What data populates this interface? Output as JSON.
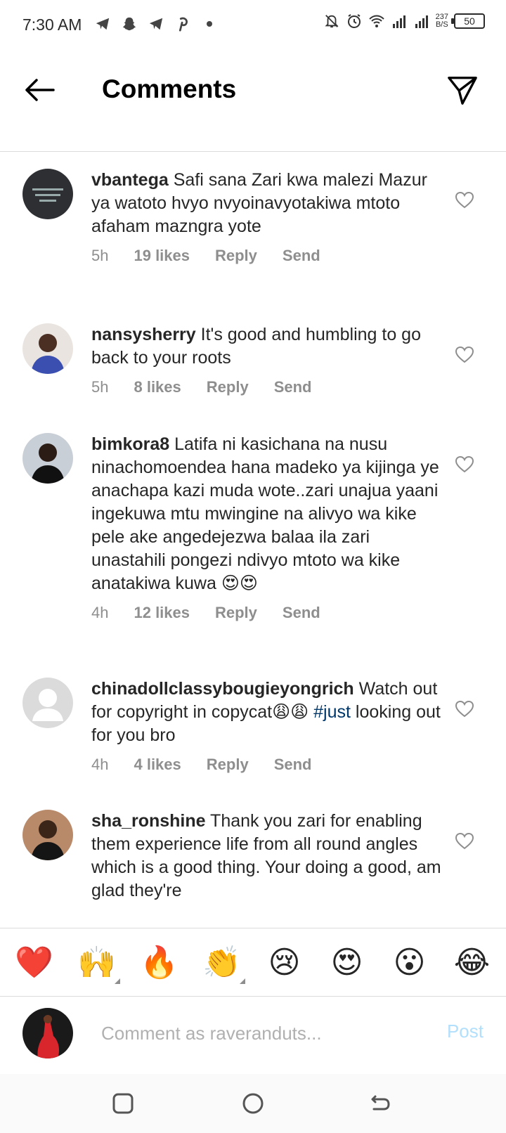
{
  "status_bar": {
    "time": "7:30 AM",
    "net_speed_value": "237",
    "net_speed_unit": "B/S",
    "battery": "50",
    "icons": [
      "telegram-icon",
      "snapchat-icon",
      "telegram-icon",
      "pinterest-icon",
      "dot-icon",
      "mute-icon",
      "alarm-icon",
      "wifi-icon",
      "signal-icon",
      "signal-icon"
    ]
  },
  "header": {
    "title": "Comments",
    "back_icon": "arrow-left-icon",
    "share_icon": "paper-plane-icon"
  },
  "comments": [
    {
      "username": "vbantega",
      "text": " Safi sana Zari kwa malezi Mazur ya watoto hvyo nvyoinavyotakiwa mtoto afaham mazngra yote",
      "time": "5h",
      "likes": "19 likes",
      "reply": "Reply",
      "send": "Send"
    },
    {
      "username": "nansysherry",
      "text": " It's good and humbling to go back to your roots",
      "time": "5h",
      "likes": "8 likes",
      "reply": "Reply",
      "send": "Send"
    },
    {
      "username": "bimkora8",
      "text": " Latifa ni kasichana na nusu  ninachomoendea hana madeko ya kijinga ye anachapa kazi muda wote..zari  unajua yaani ingekuwa mtu mwingine  na alivyo wa kike pele ake angedejezwa balaa ila zari  unastahili pongezi ndivyo  mtoto wa kike anatakiwa  kuwa 😍😍",
      "time": "4h",
      "likes": "12 likes",
      "reply": "Reply",
      "send": "Send"
    },
    {
      "username": "chinadollclassybougieyongrich",
      "text": " Watch out for copyright in copycat😩😩 ",
      "hashtag": "#just",
      "text_after": " looking out for you bro",
      "time": "4h",
      "likes": "4 likes",
      "reply": "Reply",
      "send": "Send"
    },
    {
      "username": "sha_ronshine",
      "text": " Thank you zari for enabling them experience life from all round angles which is a good thing. Your doing a good, am glad they're"
    }
  ],
  "emoji_bar": [
    "❤️",
    "🙌",
    "🔥",
    "👏",
    "😢",
    "😍",
    "😮",
    "😂"
  ],
  "composer": {
    "placeholder": "Comment as raveranduts...",
    "post_label": "Post"
  },
  "nav_bar": {
    "recents_icon": "square-icon",
    "home_icon": "circle-icon",
    "back_icon": "back-arrow-icon"
  },
  "colors": {
    "hashtag": "#00376b",
    "post_disabled": "#b2dffc",
    "meta_gray": "#8e8e8e"
  }
}
